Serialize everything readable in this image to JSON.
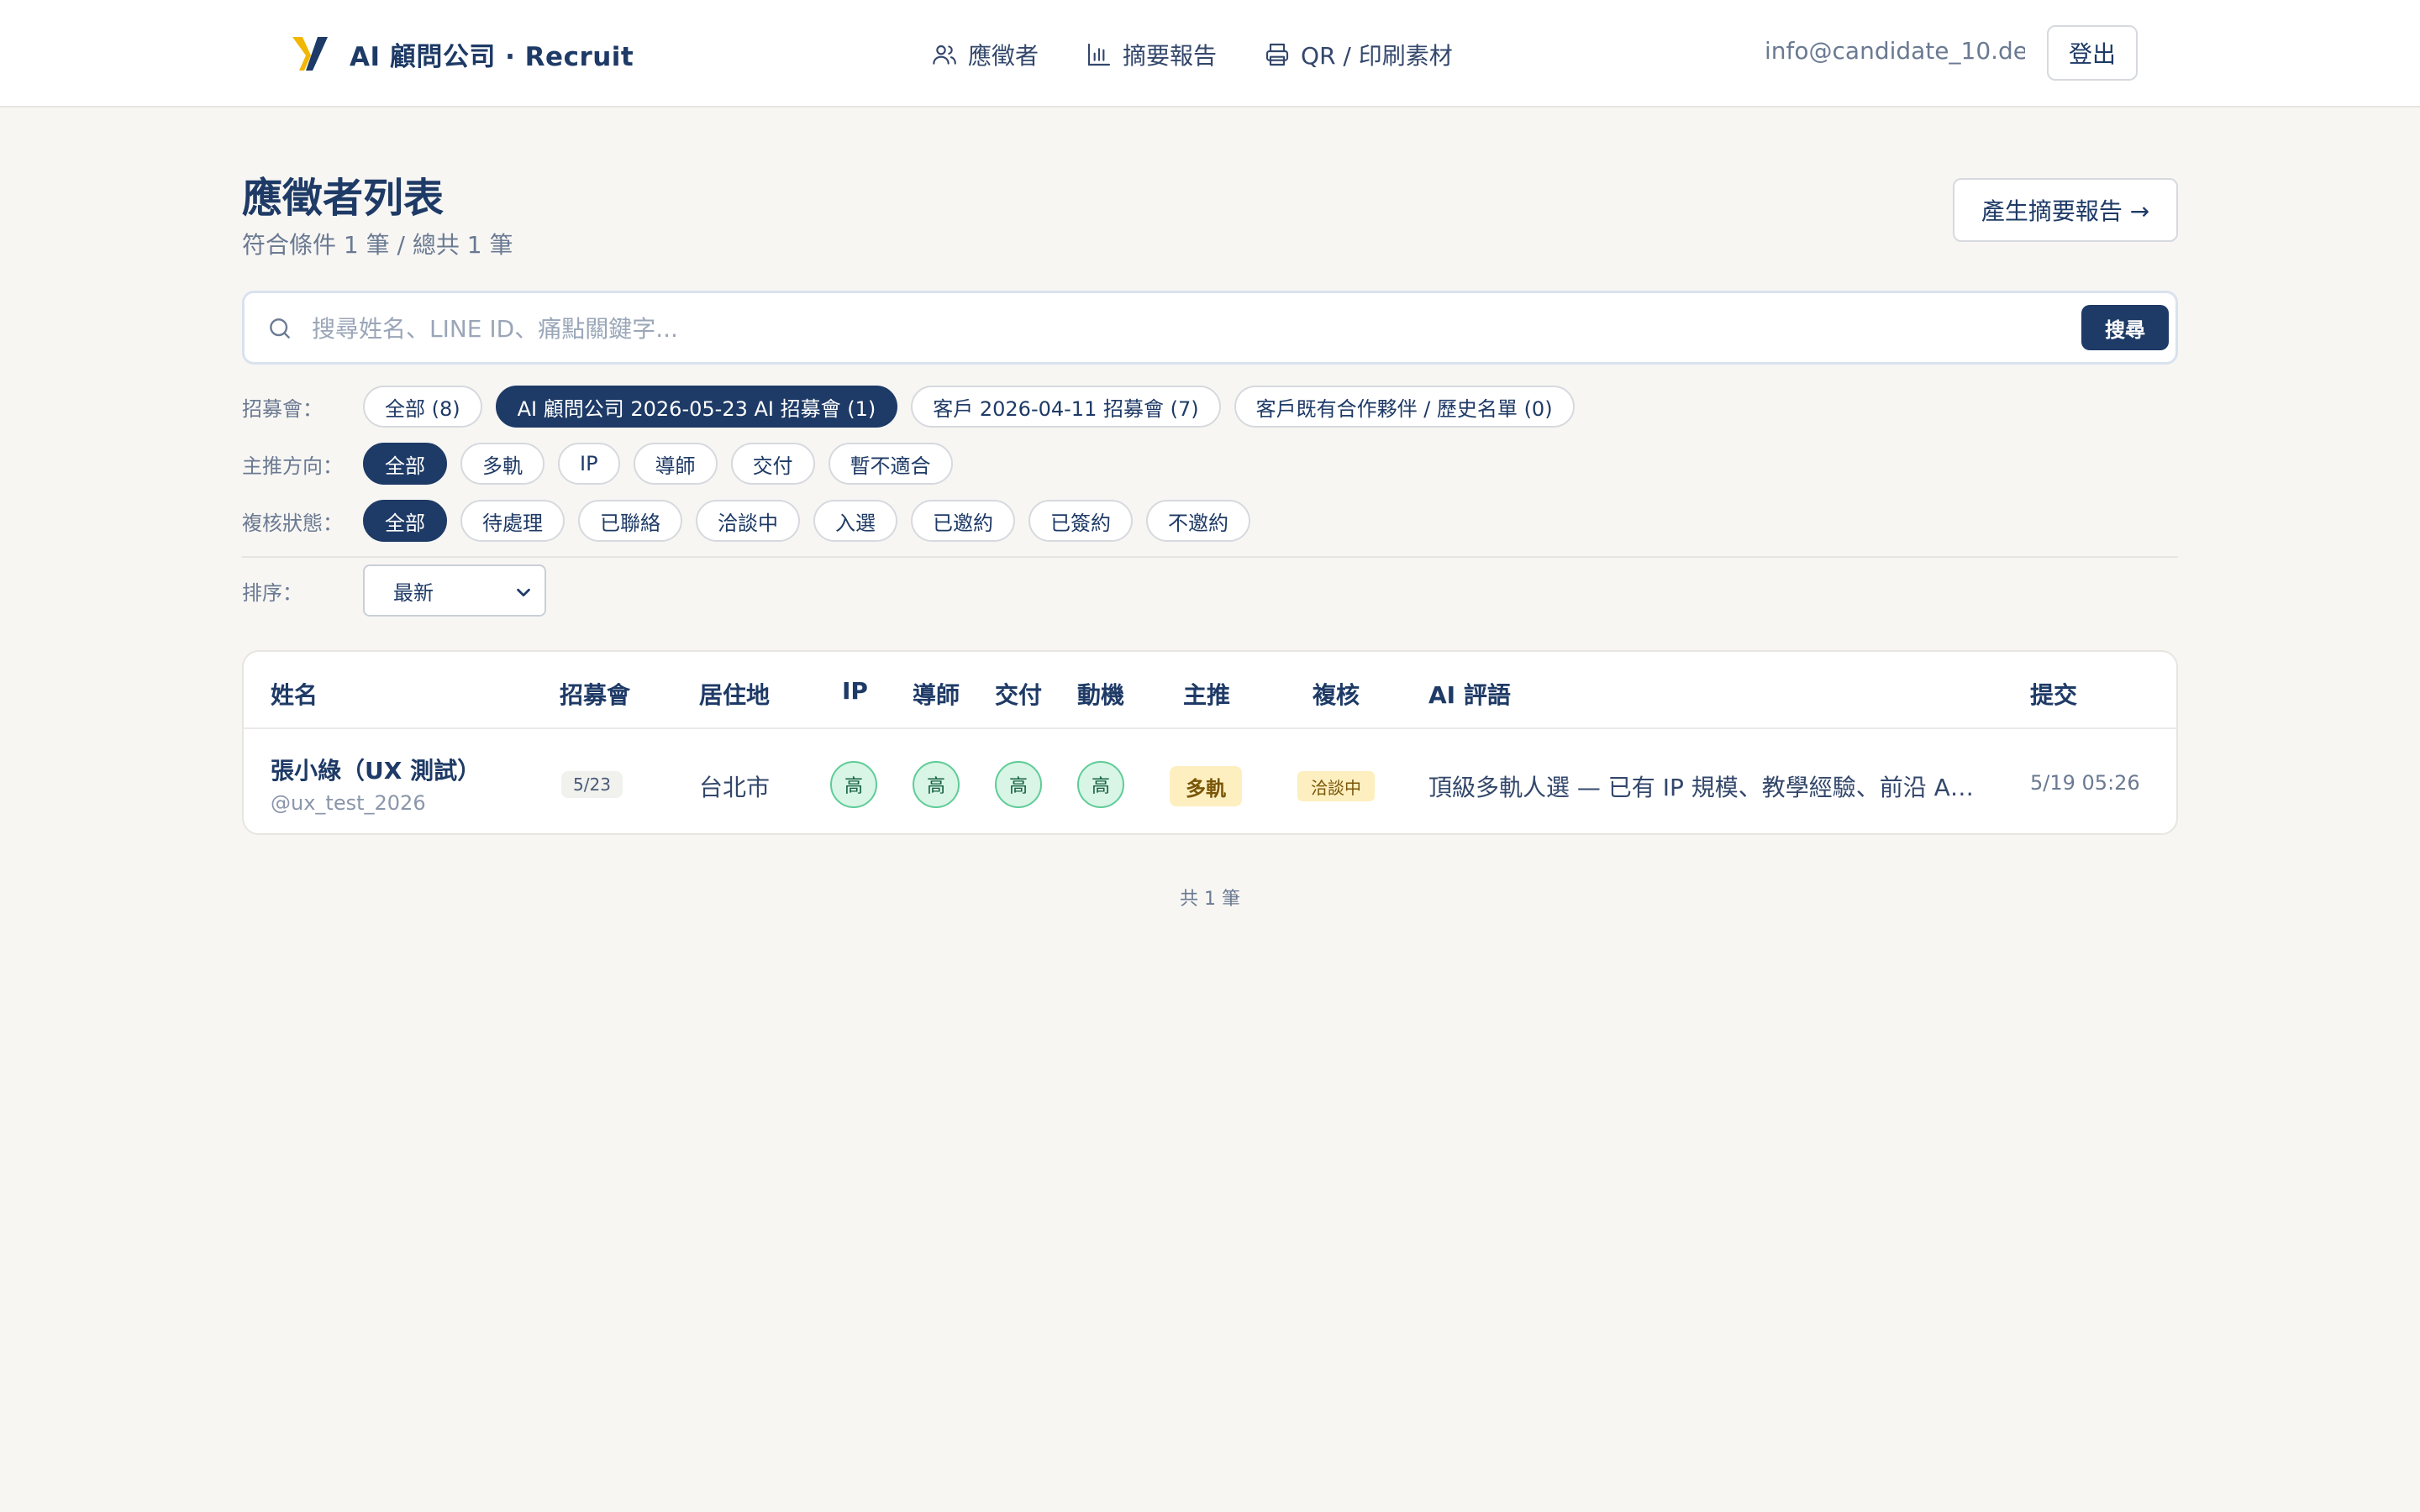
{
  "header": {
    "brand": "AI 顧問公司 · Recruit",
    "nav": [
      {
        "label": "應徵者",
        "icon": "users-icon"
      },
      {
        "label": "摘要報告",
        "icon": "bar-chart-icon"
      },
      {
        "label": "QR / 印刷素材",
        "icon": "printer-icon"
      }
    ],
    "user_email": "info@candidate_10.de...",
    "logout_label": "登出"
  },
  "page": {
    "title": "應徵者列表",
    "subtitle": "符合條件 1 筆 / 總共 1 筆",
    "report_button": "產生摘要報告 →"
  },
  "search": {
    "placeholder": "搜尋姓名、LINE ID、痛點關鍵字...",
    "value": "",
    "button": "搜尋"
  },
  "filters": {
    "event": {
      "label": "招募會：",
      "options": [
        "全部 (8)",
        "AI 顧問公司 2026-05-23 AI 招募會 (1)",
        "客戶 2026-04-11 招募會 (7)",
        "客戶既有合作夥伴 / 歷史名單 (0)"
      ],
      "active": 1
    },
    "direction": {
      "label": "主推方向：",
      "options": [
        "全部",
        "多軌",
        "IP",
        "導師",
        "交付",
        "暫不適合"
      ],
      "active": 0
    },
    "review": {
      "label": "複核狀態：",
      "options": [
        "全部",
        "待處理",
        "已聯絡",
        "洽談中",
        "入選",
        "已邀約",
        "已簽約",
        "不邀約"
      ],
      "active": 0
    },
    "sort": {
      "label": "排序：",
      "selected": "最新"
    }
  },
  "table": {
    "columns": {
      "name": "姓名",
      "event": "招募會",
      "location": "居住地",
      "ip": "IP",
      "mentor": "導師",
      "delivery": "交付",
      "motivation": "動機",
      "direction": "主推",
      "review": "複核",
      "ai_comment": "AI 評語",
      "submitted": "提交"
    },
    "rows": [
      {
        "name": "張小綠（UX 測試）",
        "handle": "@ux_test_2026",
        "event": "5/23",
        "location": "台北市",
        "ip": "高",
        "mentor": "高",
        "delivery": "高",
        "motivation": "高",
        "direction": "多軌",
        "review": "洽談中",
        "ai_comment": "頂級多軌人選 — 已有 IP 規模、教學經驗、前沿 AI ...",
        "submitted": "5/19 05:26"
      }
    ]
  },
  "footer": {
    "count": "共 1 筆"
  },
  "colors": {
    "primary": "#1e3a66",
    "accent_yellow": "#f2b705",
    "score_green": "#d8f5e6",
    "badge_yellow": "#fdefc0",
    "background": "#f7f6f3"
  }
}
